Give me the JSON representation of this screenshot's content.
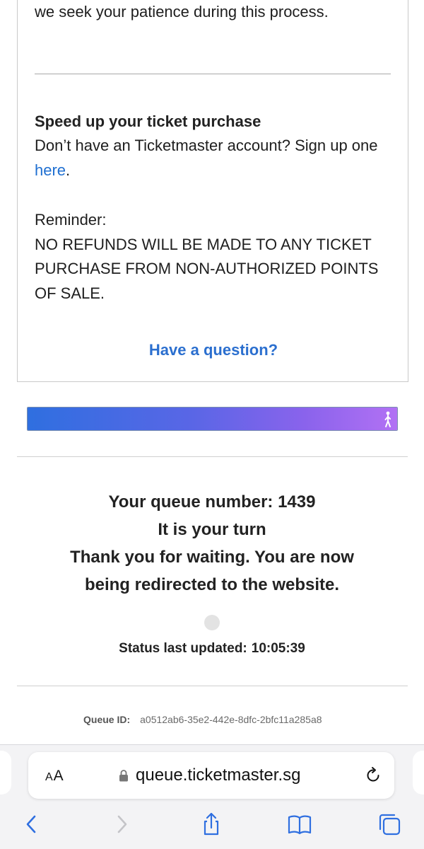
{
  "card": {
    "top_line": "we seek your patience during this process.",
    "speed_heading": "Speed up your ticket purchase",
    "speed_text": "Don’t have an Ticketmaster account? Sign up one ",
    "speed_link": "here",
    "speed_end": ".",
    "reminder_label": "Reminder:",
    "reminder_text": "NO REFUNDS WILL BE MADE TO ANY TICKET PURCHASE FROM NON-AUTHORIZED POINTS OF SALE.",
    "question_link": "Have a question?"
  },
  "progress": {
    "percent": 100,
    "start_color": "#2f6fe0",
    "end_color": "#b271f4"
  },
  "status": {
    "queue_number_line": "Your queue number: 1439",
    "turn_line": "It is your turn",
    "thanks_line1": "Thank you for waiting. You are now",
    "thanks_line2": "being redirected to the website.",
    "last_updated_label": "Status last updated:",
    "last_updated_time": "10:05:39",
    "queue_id_label": "Queue ID:",
    "queue_id_value": "a0512ab6-35e2-442e-8dfc-2bfc11a285a8"
  },
  "browser": {
    "aa_label_big": "A",
    "aa_label_small": "A",
    "url": "queue.ticketmaster.sg",
    "icons": [
      "text-size-icon",
      "lock-icon",
      "reload-icon",
      "back-icon",
      "forward-icon",
      "share-icon",
      "bookmarks-icon",
      "tabs-icon"
    ]
  },
  "colors": {
    "link": "#2b6fcf",
    "text": "#222222",
    "toolbar_blue": "#2f6fe0"
  }
}
